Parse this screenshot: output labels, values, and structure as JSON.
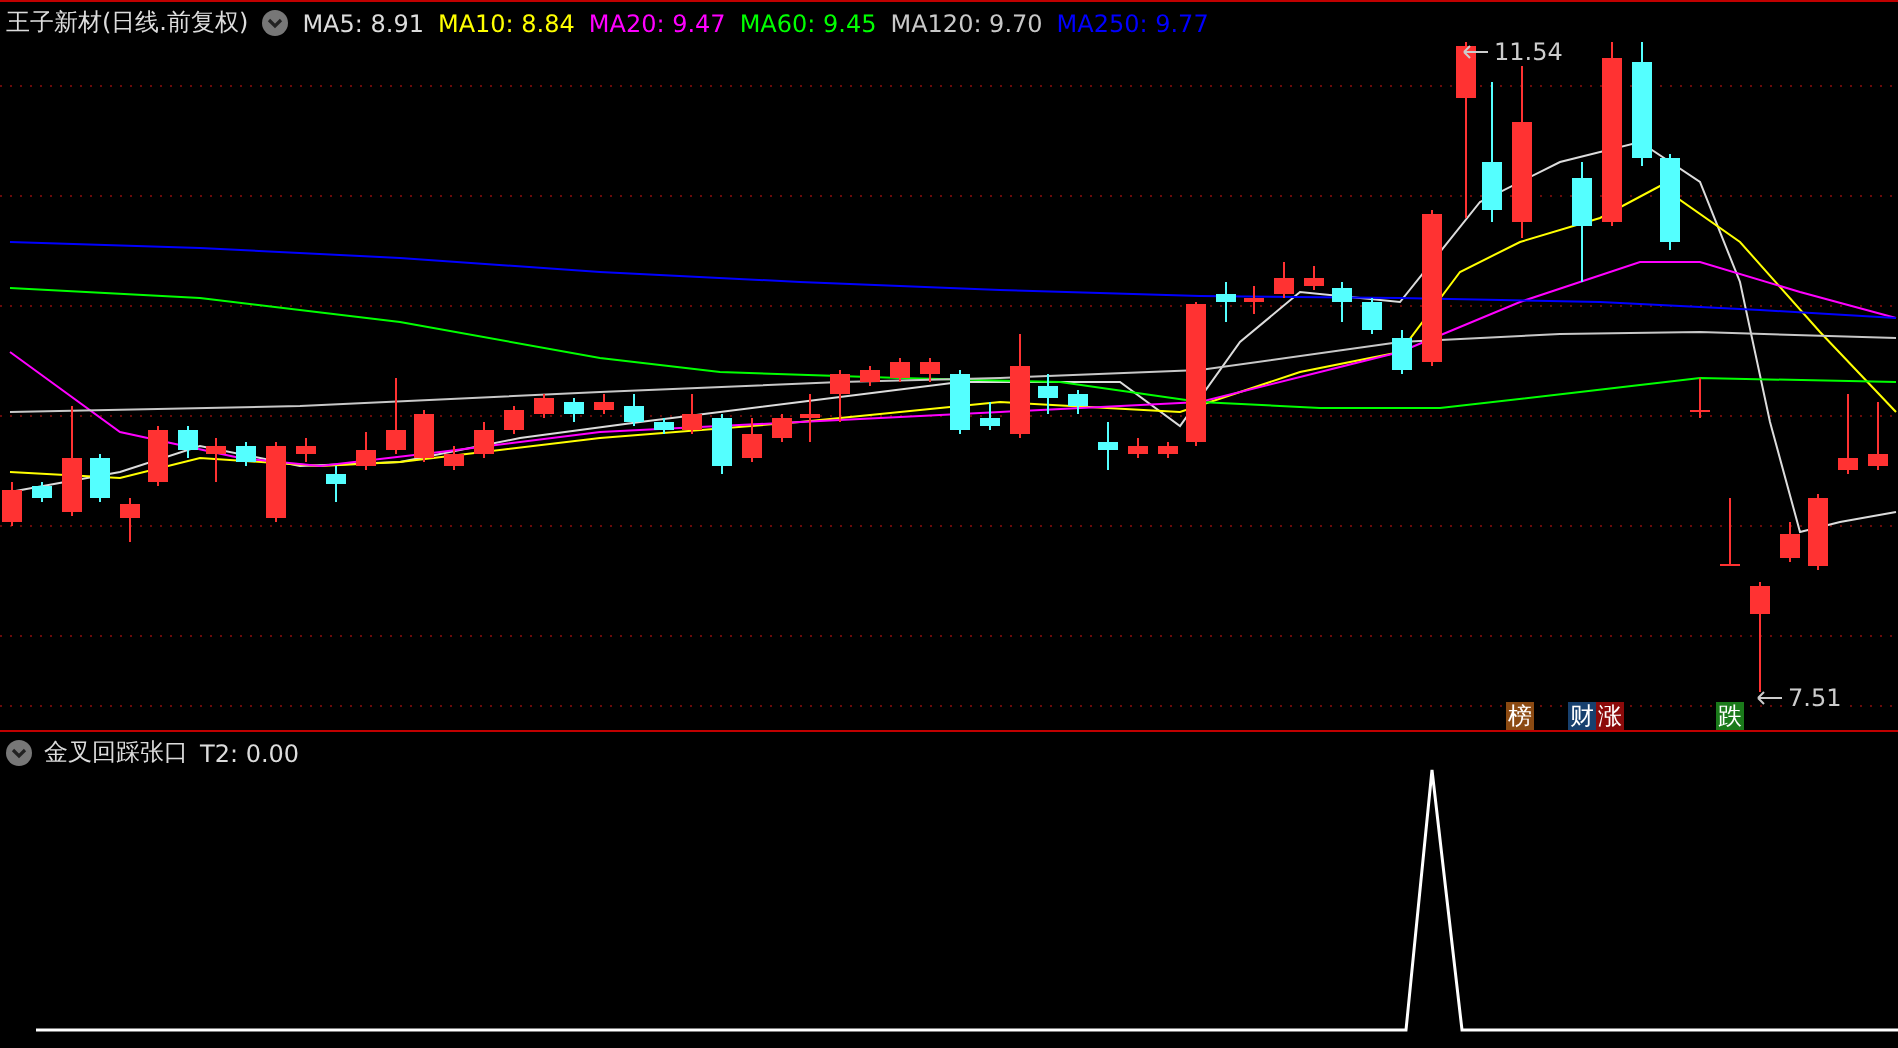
{
  "header": {
    "title": "王子新材(日线.前复权)",
    "moving_averages": [
      {
        "label": "MA5: 8.91",
        "color": "#dcdcdc"
      },
      {
        "label": "MA10: 8.84",
        "color": "#ffff00"
      },
      {
        "label": "MA20: 9.47",
        "color": "#ff00ff"
      },
      {
        "label": "MA60: 9.45",
        "color": "#00ff00"
      },
      {
        "label": "MA120: 9.70",
        "color": "#c8c8c8"
      },
      {
        "label": "MA250: 9.77",
        "color": "#0000ff"
      }
    ]
  },
  "price_labels": [
    {
      "text": "11.54",
      "kind": "high"
    },
    {
      "text": "7.51",
      "kind": "low"
    }
  ],
  "badges": [
    {
      "text": "榜",
      "color": "#8b4a12"
    },
    {
      "text": "财",
      "color": "#17406e"
    },
    {
      "text": "涨",
      "color": "#8b0a0a"
    },
    {
      "text": "跌",
      "color": "#1a7a1a"
    }
  ],
  "indicator": {
    "title": "金叉回踩张口",
    "value": "T2: 0.00"
  }
}
